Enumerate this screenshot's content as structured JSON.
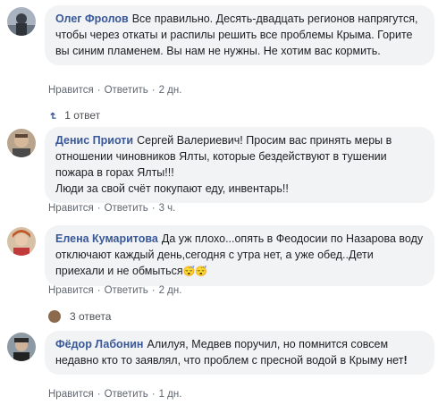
{
  "colors": {
    "bubble": "#f2f3f5",
    "author": "#385898",
    "meta": "#606770"
  },
  "comments": [
    {
      "author": "Олег Фролов",
      "text": "Все правильно. Десять-двадцать регионов напрягутся, чтобы через откаты и распилы решить все проблемы Крыма. Горите вы синим пламенем. Вы нам не нужны. Не хотим вас кормить.",
      "like": "Нравится",
      "reply": "Ответить",
      "time": "2 дн.",
      "replies": "1 ответ"
    },
    {
      "author": "Денис Приоти",
      "text_line1": "Сергей Валериевич! Просим вас принять меры в отношении чиновников Ялты, которые бездействуют в тушении пожара в горах Ялты!!!",
      "text_line2": "Люди за свой счёт покупают еду, инвентарь!!",
      "like": "Нравится",
      "reply": "Ответить",
      "time": "3 ч."
    },
    {
      "author": "Елена Кумаритова",
      "text": "Да уж плохо...опять в Феодосии по Назарова воду отключают каждый день,сегодня с утра нет, а уже обед..Дети приехали и не обмыться",
      "emoji": "😴😴",
      "like": "Нравится",
      "reply": "Ответить",
      "time": "2 дн.",
      "replies": "3 ответа"
    },
    {
      "author": "Фёдор Лабонин",
      "text": "Алилуя, Медвев поручил, но помнится совсем недавно кто то заявлял, что проблем с пресной водой в Крыму нет",
      "text_end": "!",
      "like": "Нравится",
      "reply": "Ответить",
      "time": "1 дн."
    }
  ]
}
